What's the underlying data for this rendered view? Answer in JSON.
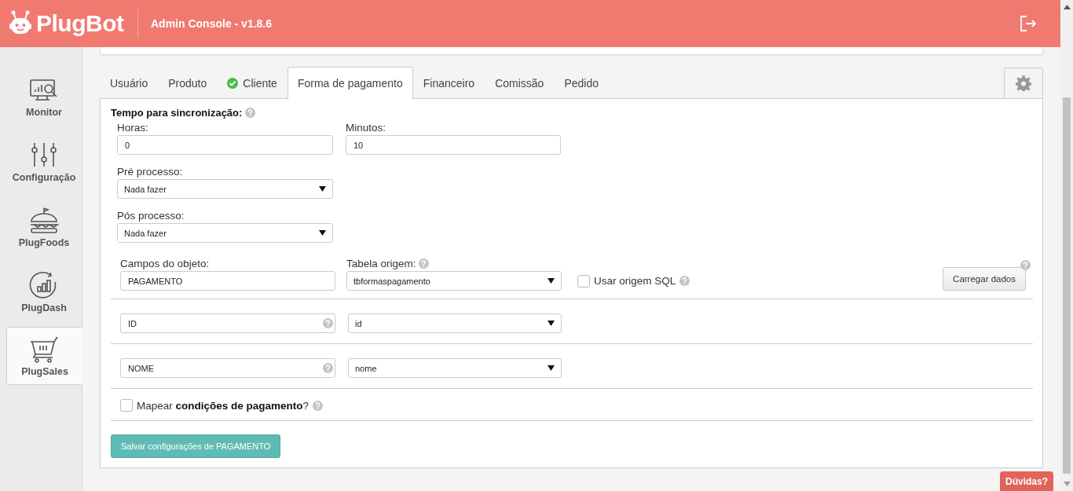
{
  "header": {
    "brand": "PlugBot",
    "subtitle": "Admin Console - v1.8.6"
  },
  "sidebar": {
    "items": [
      {
        "label": "Monitor",
        "selected": false
      },
      {
        "label": "Configuração",
        "selected": false
      },
      {
        "label": "PlugFoods",
        "selected": false
      },
      {
        "label": "PlugDash",
        "selected": false
      },
      {
        "label": "PlugSales",
        "selected": true
      }
    ]
  },
  "tabs": [
    {
      "label": "Usuário",
      "selected": false,
      "done": false
    },
    {
      "label": "Produto",
      "selected": false,
      "done": false
    },
    {
      "label": "Cliente",
      "selected": false,
      "done": true
    },
    {
      "label": "Forma de pagamento",
      "selected": true,
      "done": false
    },
    {
      "label": "Financeiro",
      "selected": false,
      "done": false
    },
    {
      "label": "Comissão",
      "selected": false,
      "done": false
    },
    {
      "label": "Pedido",
      "selected": false,
      "done": false
    }
  ],
  "form": {
    "section_title": "Tempo para sincronização:",
    "hours": {
      "label": "Horas:",
      "value": "0"
    },
    "minutes": {
      "label": "Minutos:",
      "value": "10"
    },
    "pre_process": {
      "label": "Pré processo:",
      "value": "Nada fazer"
    },
    "post_process": {
      "label": "Pós processo:",
      "value": "Nada fazer"
    },
    "object_fields": {
      "label": "Campos do objeto:",
      "value": "PAGAMENTO"
    },
    "source_table": {
      "label": "Tabela origem:",
      "value": "tbformaspagamento"
    },
    "use_sql": {
      "label": "Usar origem SQL",
      "checked": false
    },
    "load_button": "Carregar dados",
    "mappings": [
      {
        "field": "ID",
        "column": "id"
      },
      {
        "field": "NOME",
        "column": "nome"
      }
    ],
    "map_conditions": {
      "label": "Mapear **condições de pagamento**?",
      "checked": false
    },
    "save_button": "Salvar configurações de PAGAMENTO"
  },
  "help_button": "Dúvidas?"
}
